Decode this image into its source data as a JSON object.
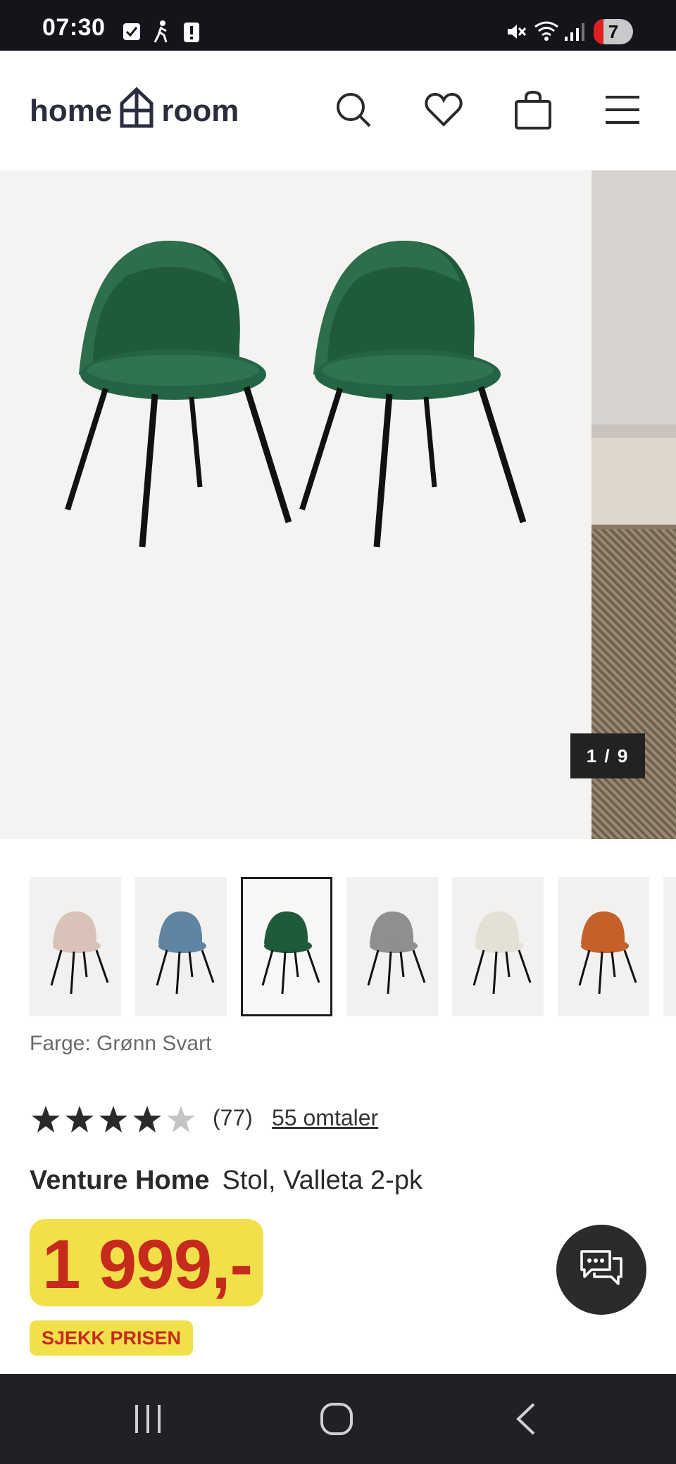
{
  "status_bar": {
    "time": "07:30",
    "notification_count": "7",
    "icons": [
      "checkbox-icon",
      "walking-icon",
      "alert-icon",
      "mute-icon",
      "wifi-icon",
      "signal-icon"
    ]
  },
  "header": {
    "logo_left": "home",
    "logo_right": "room",
    "icons": [
      "search-icon",
      "heart-icon",
      "shopping-bag-icon",
      "menu-icon"
    ]
  },
  "gallery": {
    "counter": "1 / 9",
    "current": 1,
    "total": 9
  },
  "variants": {
    "swatch_colors": [
      "#d9c2b8",
      "#5f85a3",
      "#1f5a3b",
      "#8f8f92",
      "#e4e0d6",
      "#c5602a"
    ],
    "selected_index": 2,
    "color_label": "Farge: Grønn Svart"
  },
  "rating": {
    "stars": 4,
    "max": 5,
    "count": "(77)",
    "reviews_link": "55 omtaler"
  },
  "product": {
    "brand": "Venture Home",
    "name": "Stol, Valleta 2-pk",
    "price": "1 999,-",
    "check_price": "SJEKK PRISEN"
  },
  "colors": {
    "price_bg": "#f2e04a",
    "price_text": "#c62a1c",
    "chair_green": "#1f5a3b"
  },
  "nav": {
    "icons": [
      "recent-apps-icon",
      "home-icon",
      "back-icon"
    ]
  }
}
